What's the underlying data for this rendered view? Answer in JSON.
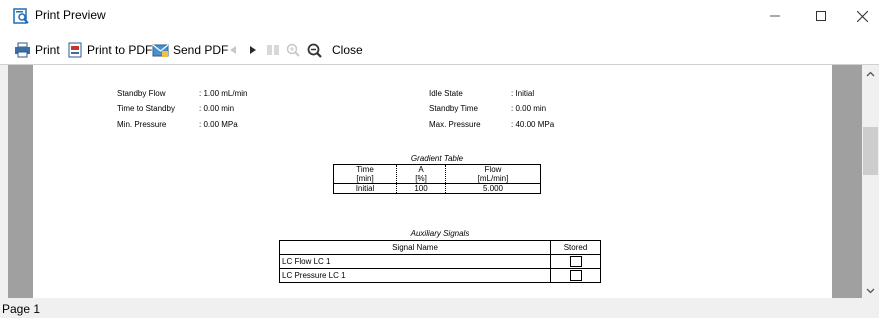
{
  "window": {
    "title": "Print Preview",
    "controls": {
      "minimize_icon": "minimize-icon",
      "maximize_icon": "maximize-icon",
      "close_icon": "close-icon"
    }
  },
  "toolbar": {
    "print_label": "Print",
    "print_pdf_label": "Print to PDF",
    "send_pdf_label": "Send PDF",
    "close_label": "Close"
  },
  "report": {
    "left_params": [
      {
        "label": "Standby Flow",
        "value": ": 1.00 mL/min"
      },
      {
        "label": "Time to Standby",
        "value": ": 0.00 min"
      },
      {
        "label": "Min. Pressure",
        "value": ": 0.00 MPa"
      }
    ],
    "right_params": [
      {
        "label": "Idle State",
        "value": ": Initial"
      },
      {
        "label": "Standby Time",
        "value": ": 0.00 min"
      },
      {
        "label": "Max. Pressure",
        "value": ": 40.00 MPa"
      }
    ],
    "gradient_table": {
      "caption": "Gradient Table",
      "headers": [
        [
          "Time",
          "[min]"
        ],
        [
          "A",
          "[%]"
        ],
        [
          "Flow",
          "[mL/min]"
        ]
      ],
      "rows": [
        [
          "Initial",
          "100",
          "5.000"
        ]
      ]
    },
    "aux_signals": {
      "caption": "Auxiliary Signals",
      "headers": [
        "Signal Name",
        "Stored"
      ],
      "rows": [
        {
          "name": "LC Flow LC 1",
          "stored": false
        },
        {
          "name": "LC Pressure LC 1",
          "stored": false
        }
      ]
    }
  },
  "status": {
    "page_label": "Page 1"
  },
  "colors": {
    "page_bg": "#ffffff",
    "preview_bg": "#a0a0a0",
    "chrome": "#f0f0f0"
  }
}
